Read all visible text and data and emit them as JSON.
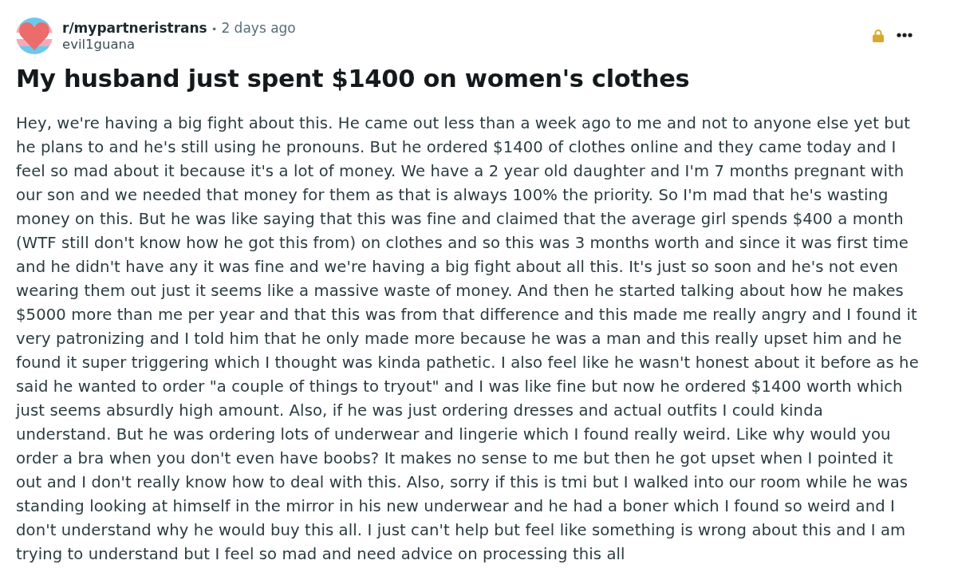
{
  "post": {
    "community": "r/mypartneristrans",
    "separator": "•",
    "time": "2 days ago",
    "author": "evil1guana",
    "locked": true,
    "title": "My husband just spent $1400 on women's clothes",
    "body": "Hey, we're having a big fight about this. He came out less than a week ago to me and not to anyone else yet but he plans to and he's still using he pronouns. But he ordered $1400 of clothes online and they came today and I feel so mad about it because it's a lot of money. We have a 2 year old daughter and I'm 7 months pregnant with our son and we needed that money for them as that is always 100% the priority. So I'm mad that he's wasting money on this. But he was like saying that this was fine and claimed that the average girl spends $400 a month (WTF still don't know how he got this from) on clothes and so this was 3 months worth and since it was first time and he didn't have any it was fine and we're having a big fight about all this. It's just so soon and he's not even wearing them out just it seems like a massive waste of money. And then he started talking about how he makes $5000 more than me per year and that this was from that difference and this made me really angry and I found it very patronizing and I told him that he only made more because he was a man and this really upset him and he found it super triggering which I thought was kinda pathetic. I also feel like he wasn't honest about it before as he said he wanted to order \"a couple of things to tryout\" and I was like fine but now he ordered $1400 worth which just seems absurdly high amount. Also, if he was just ordering dresses and actual outfits I could kinda understand. But he was ordering lots of underwear and lingerie which I found really weird. Like why would you order a bra when you don't even have boobs? It makes no sense to me but then he got upset when I pointed it out and I don't really know how to deal with this. Also, sorry if this is tmi but I walked into our room while he was standing looking at himself in the mirror in his new underwear and he had a boner which I found so weird and I don't understand why he would buy this all. I just can't help but feel like something is wrong about this and I am trying to understand but I feel so mad and need advice on processing this all"
  }
}
